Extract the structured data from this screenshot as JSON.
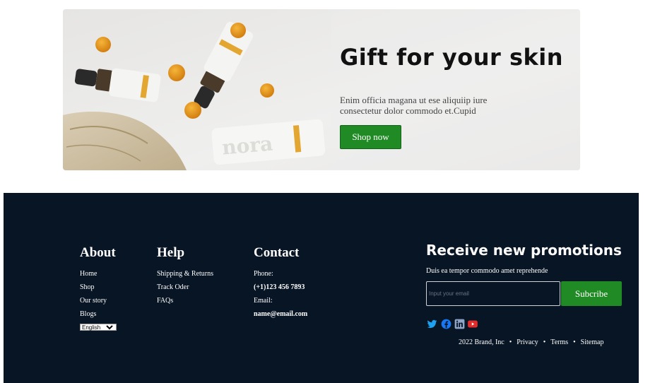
{
  "banner": {
    "title": "Gift for your skin",
    "description": "Enim officia magana ut ese aliquiip iure consectetur dolor commodo et.Cupid",
    "button_label": "Shop now",
    "product_brand": "nora"
  },
  "footer": {
    "about": {
      "title": "About",
      "links": [
        "Home",
        "Shop",
        "Our story",
        "Blogs"
      ],
      "language": "English"
    },
    "help": {
      "title": "Help",
      "links": [
        "Shipping & Returns",
        "Track Oder",
        "FAQs"
      ]
    },
    "contact": {
      "title": "Contact",
      "phone_label": "Phone:",
      "phone": "(+1)123 456 7893",
      "email_label": "Email:",
      "email": "name@email.com"
    },
    "promotions": {
      "title": "Receive new promotions",
      "subtitle": "Duis ea tempor commodo amet reprehende",
      "input_placeholder": "Input your email",
      "button_label": "Subcribe"
    },
    "social": [
      "twitter-icon",
      "facebook-icon",
      "linkedin-icon",
      "youtube-icon"
    ],
    "bottom": {
      "copyright": "2022 Brand, Inc",
      "links": [
        "Privacy",
        "Terms",
        "Sitemap"
      ]
    }
  },
  "colors": {
    "accent_green": "#208b24",
    "footer_bg": "#081525",
    "twitter": "#1da1f2",
    "facebook": "#1877f2",
    "linkedin": "#8fa5c8",
    "youtube": "#e22b2b"
  }
}
